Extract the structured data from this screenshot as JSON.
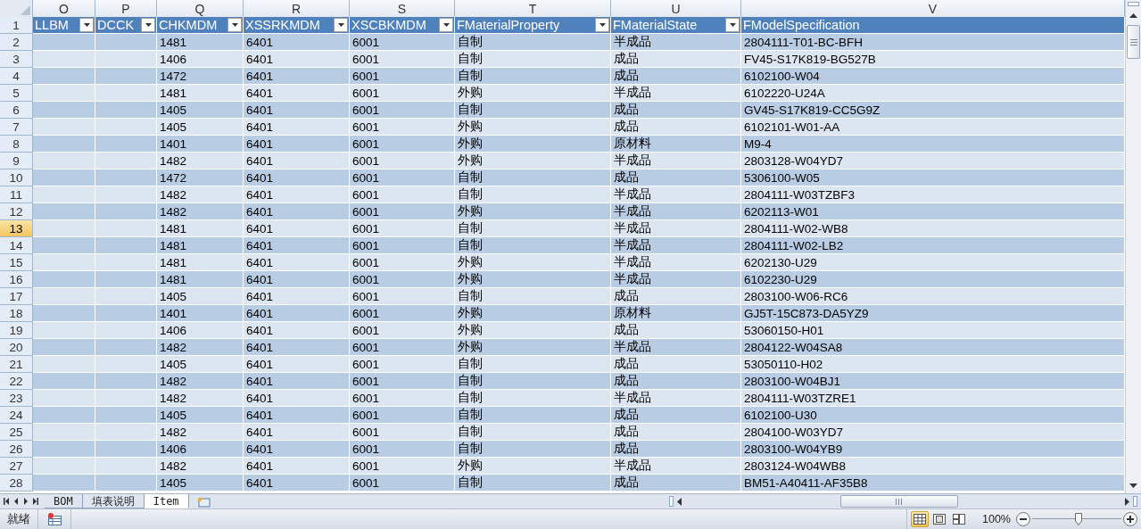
{
  "column_letters": [
    "O",
    "P",
    "Q",
    "R",
    "S",
    "T",
    "U",
    "V"
  ],
  "header_row": {
    "number": "1",
    "selected": false
  },
  "headers": [
    {
      "text": "LLBM",
      "filter": true
    },
    {
      "text": "DCCK",
      "filter": true
    },
    {
      "text": "CHKMDM",
      "filter": true
    },
    {
      "text": "XSSRKMDM",
      "filter": true
    },
    {
      "text": "XSCBKMDM",
      "filter": true
    },
    {
      "text": "FMaterialProperty",
      "filter": true
    },
    {
      "text": "FMaterialState",
      "filter": true
    },
    {
      "text": "FModelSpecification",
      "filter": false
    }
  ],
  "rows": [
    {
      "number": "2",
      "selected": false,
      "cells": {
        "Q": "1481",
        "R": "6401",
        "S": "6001",
        "T": "自制",
        "U": "半成品",
        "V": "2804111-T01-BC-BFH"
      }
    },
    {
      "number": "3",
      "selected": false,
      "cells": {
        "Q": "1406",
        "R": "6401",
        "S": "6001",
        "T": "自制",
        "U": "成品",
        "V": "FV45-S17K819-BG527B"
      }
    },
    {
      "number": "4",
      "selected": false,
      "cells": {
        "Q": "1472",
        "R": "6401",
        "S": "6001",
        "T": "自制",
        "U": "成品",
        "V": "6102100-W04"
      }
    },
    {
      "number": "5",
      "selected": false,
      "cells": {
        "Q": "1481",
        "R": "6401",
        "S": "6001",
        "T": "外购",
        "U": "半成品",
        "V": "6102220-U24A"
      }
    },
    {
      "number": "6",
      "selected": false,
      "cells": {
        "Q": "1405",
        "R": "6401",
        "S": "6001",
        "T": "自制",
        "U": "成品",
        "V": "GV45-S17K819-CC5G9Z"
      }
    },
    {
      "number": "7",
      "selected": false,
      "cells": {
        "Q": "1405",
        "R": "6401",
        "S": "6001",
        "T": "外购",
        "U": "成品",
        "V": "6102101-W01-AA"
      }
    },
    {
      "number": "8",
      "selected": false,
      "cells": {
        "Q": "1401",
        "R": "6401",
        "S": "6001",
        "T": "外购",
        "U": "原材料",
        "V": "M9-4"
      }
    },
    {
      "number": "9",
      "selected": false,
      "cells": {
        "Q": "1482",
        "R": "6401",
        "S": "6001",
        "T": "外购",
        "U": "半成品",
        "V": "2803128-W04YD7"
      }
    },
    {
      "number": "10",
      "selected": false,
      "cells": {
        "Q": "1472",
        "R": "6401",
        "S": "6001",
        "T": "自制",
        "U": "成品",
        "V": "5306100-W05"
      }
    },
    {
      "number": "11",
      "selected": false,
      "cells": {
        "Q": "1482",
        "R": "6401",
        "S": "6001",
        "T": "自制",
        "U": "半成品",
        "V": "2804111-W03TZBF3"
      }
    },
    {
      "number": "12",
      "selected": false,
      "cells": {
        "Q": "1482",
        "R": "6401",
        "S": "6001",
        "T": "外购",
        "U": "半成品",
        "V": "6202113-W01"
      }
    },
    {
      "number": "13",
      "selected": true,
      "cells": {
        "Q": "1481",
        "R": "6401",
        "S": "6001",
        "T": "自制",
        "U": "半成品",
        "V": "2804111-W02-WB8"
      }
    },
    {
      "number": "14",
      "selected": false,
      "cells": {
        "Q": "1481",
        "R": "6401",
        "S": "6001",
        "T": "自制",
        "U": "半成品",
        "V": "2804111-W02-LB2"
      }
    },
    {
      "number": "15",
      "selected": false,
      "cells": {
        "Q": "1481",
        "R": "6401",
        "S": "6001",
        "T": "外购",
        "U": "半成品",
        "V": "6202130-U29"
      }
    },
    {
      "number": "16",
      "selected": false,
      "cells": {
        "Q": "1481",
        "R": "6401",
        "S": "6001",
        "T": "外购",
        "U": "半成品",
        "V": "6102230-U29"
      }
    },
    {
      "number": "17",
      "selected": false,
      "cells": {
        "Q": "1405",
        "R": "6401",
        "S": "6001",
        "T": "自制",
        "U": "成品",
        "V": "2803100-W06-RC6"
      }
    },
    {
      "number": "18",
      "selected": false,
      "cells": {
        "Q": "1401",
        "R": "6401",
        "S": "6001",
        "T": "外购",
        "U": "原材料",
        "V": "GJ5T-15C873-DA5YZ9"
      }
    },
    {
      "number": "19",
      "selected": false,
      "cells": {
        "Q": "1406",
        "R": "6401",
        "S": "6001",
        "T": "外购",
        "U": "成品",
        "V": "53060150-H01"
      }
    },
    {
      "number": "20",
      "selected": false,
      "cells": {
        "Q": "1482",
        "R": "6401",
        "S": "6001",
        "T": "外购",
        "U": "半成品",
        "V": "2804122-W04SA8"
      }
    },
    {
      "number": "21",
      "selected": false,
      "cells": {
        "Q": "1405",
        "R": "6401",
        "S": "6001",
        "T": "自制",
        "U": "成品",
        "V": "53050110-H02"
      }
    },
    {
      "number": "22",
      "selected": false,
      "cells": {
        "Q": "1482",
        "R": "6401",
        "S": "6001",
        "T": "自制",
        "U": "成品",
        "V": "2803100-W04BJ1"
      }
    },
    {
      "number": "23",
      "selected": false,
      "cells": {
        "Q": "1482",
        "R": "6401",
        "S": "6001",
        "T": "自制",
        "U": "半成品",
        "V": "2804111-W03TZRE1"
      }
    },
    {
      "number": "24",
      "selected": false,
      "cells": {
        "Q": "1405",
        "R": "6401",
        "S": "6001",
        "T": "自制",
        "U": "成品",
        "V": "6102100-U30"
      }
    },
    {
      "number": "25",
      "selected": false,
      "cells": {
        "Q": "1482",
        "R": "6401",
        "S": "6001",
        "T": "自制",
        "U": "成品",
        "V": "2804100-W03YD7"
      }
    },
    {
      "number": "26",
      "selected": false,
      "cells": {
        "Q": "1406",
        "R": "6401",
        "S": "6001",
        "T": "自制",
        "U": "成品",
        "V": "2803100-W04YB9"
      }
    },
    {
      "number": "27",
      "selected": false,
      "cells": {
        "Q": "1482",
        "R": "6401",
        "S": "6001",
        "T": "外购",
        "U": "半成品",
        "V": "2803124-W04WB8"
      }
    },
    {
      "number": "28",
      "selected": false,
      "cells": {
        "Q": "1405",
        "R": "6401",
        "S": "6001",
        "T": "自制",
        "U": "成品",
        "V": "BM51-A40411-AF35B8"
      }
    }
  ],
  "sheet_tabs": [
    {
      "label": "BOM",
      "selected": false
    },
    {
      "label": "填表说明",
      "selected": false
    },
    {
      "label": "Item",
      "selected": true
    }
  ],
  "status_bar": {
    "text": "就绪",
    "views": [
      {
        "kind": "normal",
        "selected": true
      },
      {
        "kind": "page_layout",
        "selected": false
      },
      {
        "kind": "page_break",
        "selected": false
      }
    ],
    "zoom": {
      "reading": "100%",
      "level": 0.52
    }
  }
}
